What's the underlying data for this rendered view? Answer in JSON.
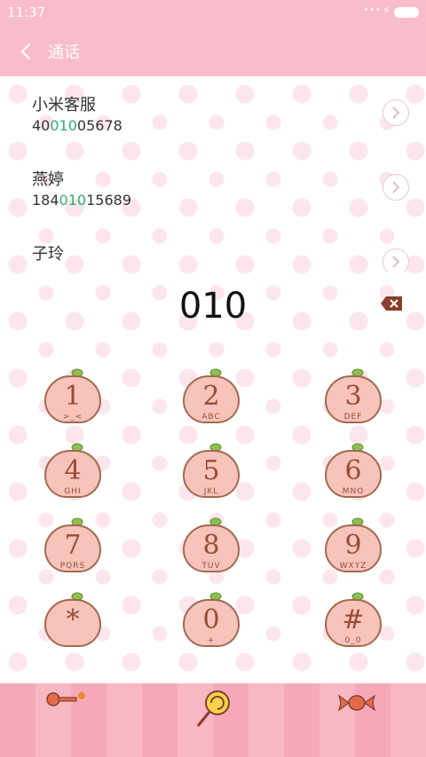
{
  "status": {
    "time": "11:37"
  },
  "header": {
    "title": "通话"
  },
  "contacts": [
    {
      "name": "小米客服",
      "number_prefix": "40",
      "number_match": "010",
      "number_suffix": "05678"
    },
    {
      "name": "燕婷",
      "number_prefix": "184",
      "number_match": "010",
      "number_suffix": "15689"
    },
    {
      "name": "子玲",
      "number_prefix": "",
      "number_match": "",
      "number_suffix": ""
    }
  ],
  "dialer": {
    "entered_number": "010"
  },
  "keypad": [
    {
      "digit": "1",
      "letters": ">_<"
    },
    {
      "digit": "2",
      "letters": "ABC"
    },
    {
      "digit": "3",
      "letters": "DEF"
    },
    {
      "digit": "4",
      "letters": "GHI"
    },
    {
      "digit": "5",
      "letters": "JKL"
    },
    {
      "digit": "6",
      "letters": "MNO"
    },
    {
      "digit": "7",
      "letters": "PQRS"
    },
    {
      "digit": "8",
      "letters": "TUV"
    },
    {
      "digit": "9",
      "letters": "WXYZ"
    },
    {
      "digit": "*",
      "letters": ""
    },
    {
      "digit": "0",
      "letters": "+"
    },
    {
      "digit": "#",
      "letters": "0_0"
    }
  ],
  "bottom_nav": [
    {
      "icon": "key-icon"
    },
    {
      "icon": "lollipop-icon"
    },
    {
      "icon": "candy-icon"
    }
  ],
  "colors": {
    "accent_pink": "#f9bccb",
    "match_green": "#2fae6e",
    "peach_brown": "#9a4d34"
  }
}
